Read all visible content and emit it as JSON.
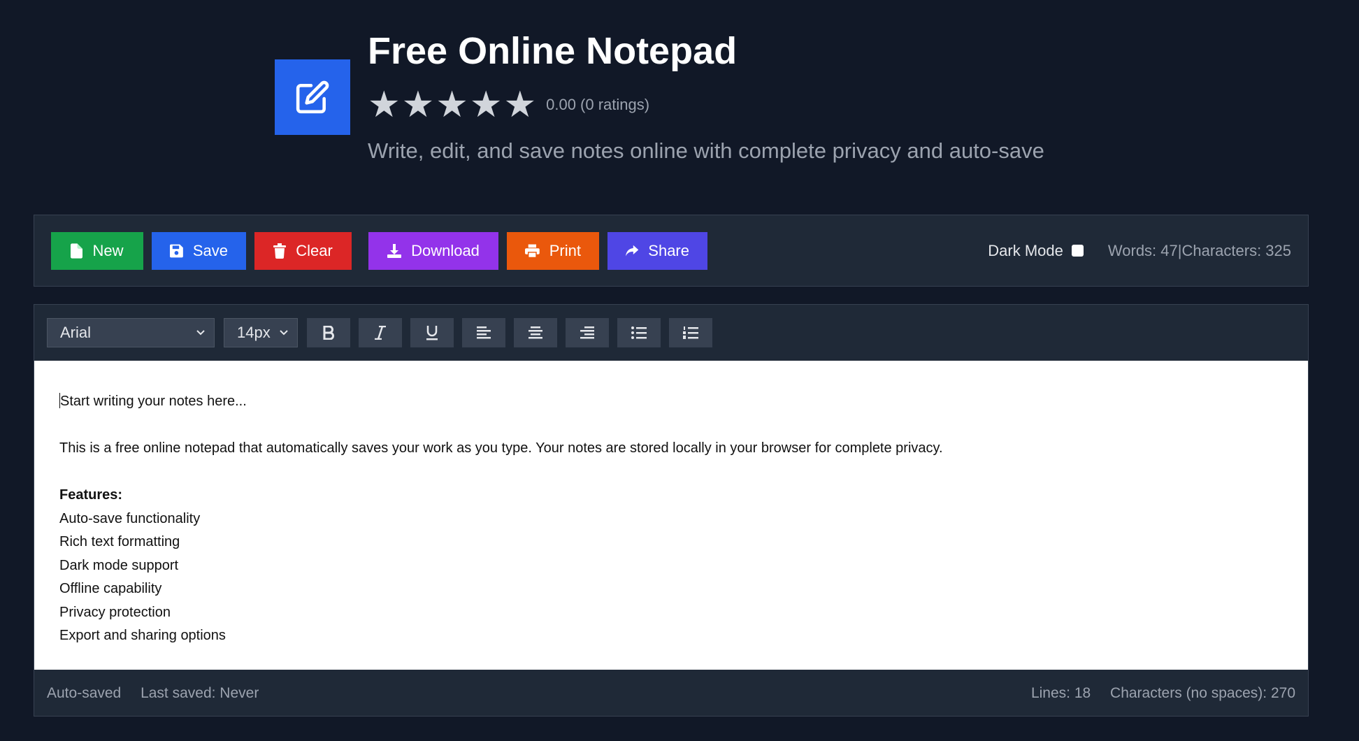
{
  "header": {
    "title": "Free Online Notepad",
    "rating_text": "0.00 (0 ratings)",
    "stars": 5,
    "subtitle": "Write, edit, and save notes online with complete privacy and auto-save",
    "logo_icon": "edit-icon",
    "logo_color": "#2563eb"
  },
  "toolbar": {
    "buttons": [
      {
        "label": "New",
        "icon": "file-icon",
        "color": "#16a34a"
      },
      {
        "label": "Save",
        "icon": "floppy-icon",
        "color": "#2563eb"
      },
      {
        "label": "Clear",
        "icon": "trash-icon",
        "color": "#dc2626"
      },
      {
        "label": "Download",
        "icon": "download-icon",
        "color": "#9333ea"
      },
      {
        "label": "Print",
        "icon": "printer-icon",
        "color": "#ea580c"
      },
      {
        "label": "Share",
        "icon": "share-icon",
        "color": "#4f46e5"
      }
    ],
    "dark_mode_label": "Dark Mode",
    "dark_mode_checked": false,
    "words": "Words: 47",
    "separator": "|",
    "characters": "Characters: 325"
  },
  "format_bar": {
    "font": "Arial",
    "size": "14px",
    "buttons": [
      "bold",
      "italic",
      "underline",
      "align-left",
      "align-center",
      "align-right",
      "bullet-list",
      "numbered-list"
    ]
  },
  "editor": {
    "line1": "Start writing your notes here...",
    "line2": "This is a free online notepad that automatically saves your work as you type. Your notes are stored locally in your browser for complete privacy.",
    "features_heading": "Features:",
    "features": [
      "Auto-save functionality",
      "Rich text formatting",
      "Dark mode support",
      "Offline capability",
      "Privacy protection",
      "Export and sharing options"
    ]
  },
  "footer": {
    "autosaved": "Auto-saved",
    "last_saved": "Last saved: Never",
    "lines": "Lines: 18",
    "chars_no_spaces": "Characters (no spaces): 270"
  }
}
